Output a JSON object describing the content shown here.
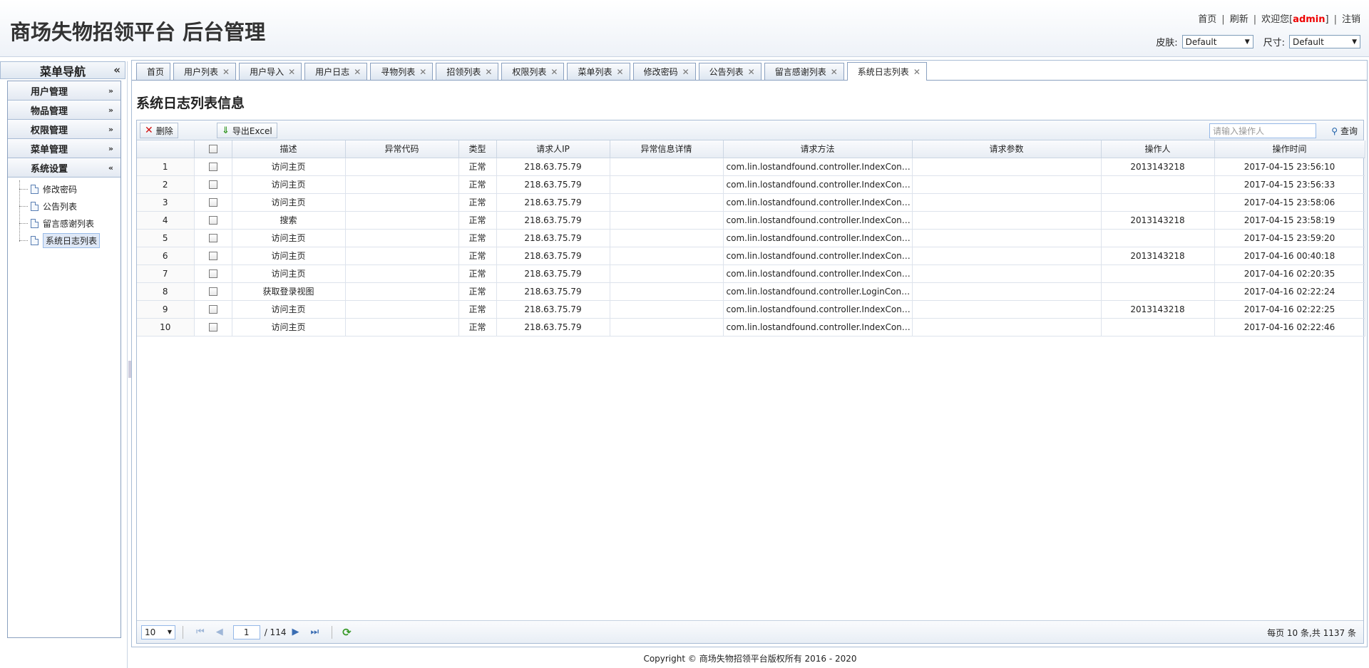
{
  "header": {
    "app_title": "商场失物招领平台 后台管理",
    "links": {
      "home": "首页",
      "refresh": "刷新",
      "welcome_prefix": "欢迎您[",
      "username": "admin",
      "welcome_suffix": "]",
      "logout": "注销"
    },
    "skin_label": "皮肤:",
    "skin_value": "Default",
    "size_label": "尺寸:",
    "size_value": "Default"
  },
  "sidebar": {
    "title": "菜单导航",
    "collapse_glyph": "«",
    "menus": [
      {
        "label": "用户管理",
        "chev": "»"
      },
      {
        "label": "物品管理",
        "chev": "»"
      },
      {
        "label": "权限管理",
        "chev": "»"
      },
      {
        "label": "菜单管理",
        "chev": "»"
      },
      {
        "label": "系统设置",
        "chev": "«"
      }
    ],
    "tree_items": [
      "修改密码",
      "公告列表",
      "留言感谢列表",
      "系统日志列表"
    ]
  },
  "tabs": [
    {
      "label": "首页",
      "closable": false
    },
    {
      "label": "用户列表",
      "closable": true
    },
    {
      "label": "用户导入",
      "closable": true
    },
    {
      "label": "用户日志",
      "closable": true
    },
    {
      "label": "寻物列表",
      "closable": true
    },
    {
      "label": "招领列表",
      "closable": true
    },
    {
      "label": "权限列表",
      "closable": true
    },
    {
      "label": "菜单列表",
      "closable": true
    },
    {
      "label": "修改密码",
      "closable": true
    },
    {
      "label": "公告列表",
      "closable": true
    },
    {
      "label": "留言感谢列表",
      "closable": true
    },
    {
      "label": "系统日志列表",
      "closable": true,
      "active": true
    }
  ],
  "close_glyph": "✕",
  "page_title": "系统日志列表信息",
  "toolbar": {
    "delete_label": "删除",
    "export_label": "导出Excel",
    "search_placeholder": "请输入操作人",
    "search_label": "查询"
  },
  "table": {
    "columns": [
      "描述",
      "异常代码",
      "类型",
      "请求人IP",
      "异常信息详情",
      "请求方法",
      "请求参数",
      "操作人",
      "操作时间"
    ],
    "rows": [
      {
        "n": "1",
        "desc": "访问主页",
        "code": "",
        "type": "正常",
        "ip": "218.63.75.79",
        "detail": "",
        "method": "com.lin.lostandfound.controller.IndexControlle...",
        "params": "",
        "op": "2013143218",
        "time": "2017-04-15 23:56:10"
      },
      {
        "n": "2",
        "desc": "访问主页",
        "code": "",
        "type": "正常",
        "ip": "218.63.75.79",
        "detail": "",
        "method": "com.lin.lostandfound.controller.IndexControlle...",
        "params": "",
        "op": "",
        "time": "2017-04-15 23:56:33"
      },
      {
        "n": "3",
        "desc": "访问主页",
        "code": "",
        "type": "正常",
        "ip": "218.63.75.79",
        "detail": "",
        "method": "com.lin.lostandfound.controller.IndexControlle...",
        "params": "",
        "op": "",
        "time": "2017-04-15 23:58:06"
      },
      {
        "n": "4",
        "desc": "搜索",
        "code": "",
        "type": "正常",
        "ip": "218.63.75.79",
        "detail": "",
        "method": "com.lin.lostandfound.controller.IndexControlle...",
        "params": "",
        "op": "2013143218",
        "time": "2017-04-15 23:58:19"
      },
      {
        "n": "5",
        "desc": "访问主页",
        "code": "",
        "type": "正常",
        "ip": "218.63.75.79",
        "detail": "",
        "method": "com.lin.lostandfound.controller.IndexControlle...",
        "params": "",
        "op": "",
        "time": "2017-04-15 23:59:20"
      },
      {
        "n": "6",
        "desc": "访问主页",
        "code": "",
        "type": "正常",
        "ip": "218.63.75.79",
        "detail": "",
        "method": "com.lin.lostandfound.controller.IndexControlle...",
        "params": "",
        "op": "2013143218",
        "time": "2017-04-16 00:40:18"
      },
      {
        "n": "7",
        "desc": "访问主页",
        "code": "",
        "type": "正常",
        "ip": "218.63.75.79",
        "detail": "",
        "method": "com.lin.lostandfound.controller.IndexControlle...",
        "params": "",
        "op": "",
        "time": "2017-04-16 02:20:35"
      },
      {
        "n": "8",
        "desc": "获取登录视图",
        "code": "",
        "type": "正常",
        "ip": "218.63.75.79",
        "detail": "",
        "method": "com.lin.lostandfound.controller.LoginControlle...",
        "params": "",
        "op": "",
        "time": "2017-04-16 02:22:24"
      },
      {
        "n": "9",
        "desc": "访问主页",
        "code": "",
        "type": "正常",
        "ip": "218.63.75.79",
        "detail": "",
        "method": "com.lin.lostandfound.controller.IndexControlle...",
        "params": "",
        "op": "2013143218",
        "time": "2017-04-16 02:22:25"
      },
      {
        "n": "10",
        "desc": "访问主页",
        "code": "",
        "type": "正常",
        "ip": "218.63.75.79",
        "detail": "",
        "method": "com.lin.lostandfound.controller.IndexControlle...",
        "params": "",
        "op": "",
        "time": "2017-04-16 02:22:46"
      }
    ]
  },
  "pager": {
    "page_size": "10",
    "current_page": "1",
    "total_pages": "/ 114",
    "info": "每页 10 条,共 1137 条"
  },
  "footer": "Copyright © 商场失物招领平台版权所有  2016 - 2020"
}
